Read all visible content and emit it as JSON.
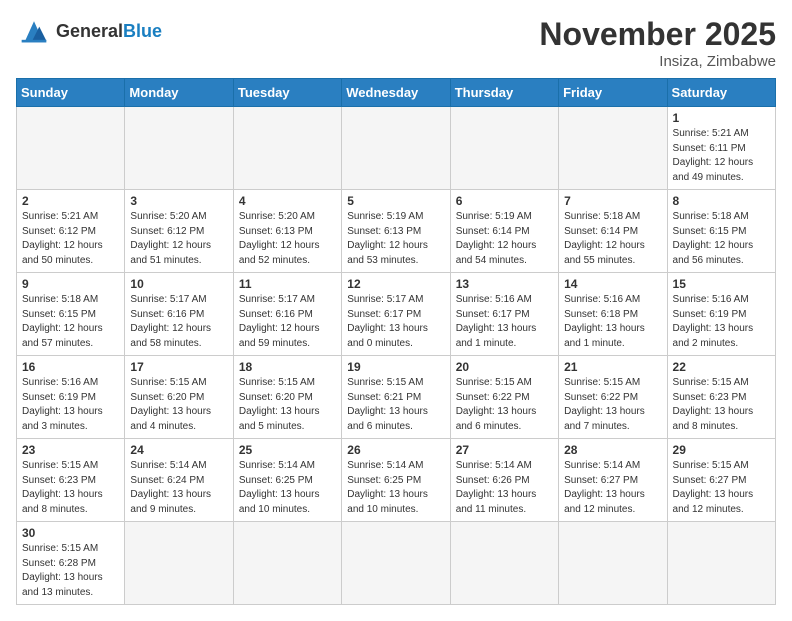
{
  "header": {
    "logo_general": "General",
    "logo_blue": "Blue",
    "month_title": "November 2025",
    "location": "Insiza, Zimbabwe"
  },
  "days_of_week": [
    "Sunday",
    "Monday",
    "Tuesday",
    "Wednesday",
    "Thursday",
    "Friday",
    "Saturday"
  ],
  "weeks": [
    [
      {
        "day": "",
        "info": ""
      },
      {
        "day": "",
        "info": ""
      },
      {
        "day": "",
        "info": ""
      },
      {
        "day": "",
        "info": ""
      },
      {
        "day": "",
        "info": ""
      },
      {
        "day": "",
        "info": ""
      },
      {
        "day": "1",
        "info": "Sunrise: 5:21 AM\nSunset: 6:11 PM\nDaylight: 12 hours\nand 49 minutes."
      }
    ],
    [
      {
        "day": "2",
        "info": "Sunrise: 5:21 AM\nSunset: 6:12 PM\nDaylight: 12 hours\nand 50 minutes."
      },
      {
        "day": "3",
        "info": "Sunrise: 5:20 AM\nSunset: 6:12 PM\nDaylight: 12 hours\nand 51 minutes."
      },
      {
        "day": "4",
        "info": "Sunrise: 5:20 AM\nSunset: 6:13 PM\nDaylight: 12 hours\nand 52 minutes."
      },
      {
        "day": "5",
        "info": "Sunrise: 5:19 AM\nSunset: 6:13 PM\nDaylight: 12 hours\nand 53 minutes."
      },
      {
        "day": "6",
        "info": "Sunrise: 5:19 AM\nSunset: 6:14 PM\nDaylight: 12 hours\nand 54 minutes."
      },
      {
        "day": "7",
        "info": "Sunrise: 5:18 AM\nSunset: 6:14 PM\nDaylight: 12 hours\nand 55 minutes."
      },
      {
        "day": "8",
        "info": "Sunrise: 5:18 AM\nSunset: 6:15 PM\nDaylight: 12 hours\nand 56 minutes."
      }
    ],
    [
      {
        "day": "9",
        "info": "Sunrise: 5:18 AM\nSunset: 6:15 PM\nDaylight: 12 hours\nand 57 minutes."
      },
      {
        "day": "10",
        "info": "Sunrise: 5:17 AM\nSunset: 6:16 PM\nDaylight: 12 hours\nand 58 minutes."
      },
      {
        "day": "11",
        "info": "Sunrise: 5:17 AM\nSunset: 6:16 PM\nDaylight: 12 hours\nand 59 minutes."
      },
      {
        "day": "12",
        "info": "Sunrise: 5:17 AM\nSunset: 6:17 PM\nDaylight: 13 hours\nand 0 minutes."
      },
      {
        "day": "13",
        "info": "Sunrise: 5:16 AM\nSunset: 6:17 PM\nDaylight: 13 hours\nand 1 minute."
      },
      {
        "day": "14",
        "info": "Sunrise: 5:16 AM\nSunset: 6:18 PM\nDaylight: 13 hours\nand 1 minute."
      },
      {
        "day": "15",
        "info": "Sunrise: 5:16 AM\nSunset: 6:19 PM\nDaylight: 13 hours\nand 2 minutes."
      }
    ],
    [
      {
        "day": "16",
        "info": "Sunrise: 5:16 AM\nSunset: 6:19 PM\nDaylight: 13 hours\nand 3 minutes."
      },
      {
        "day": "17",
        "info": "Sunrise: 5:15 AM\nSunset: 6:20 PM\nDaylight: 13 hours\nand 4 minutes."
      },
      {
        "day": "18",
        "info": "Sunrise: 5:15 AM\nSunset: 6:20 PM\nDaylight: 13 hours\nand 5 minutes."
      },
      {
        "day": "19",
        "info": "Sunrise: 5:15 AM\nSunset: 6:21 PM\nDaylight: 13 hours\nand 6 minutes."
      },
      {
        "day": "20",
        "info": "Sunrise: 5:15 AM\nSunset: 6:22 PM\nDaylight: 13 hours\nand 6 minutes."
      },
      {
        "day": "21",
        "info": "Sunrise: 5:15 AM\nSunset: 6:22 PM\nDaylight: 13 hours\nand 7 minutes."
      },
      {
        "day": "22",
        "info": "Sunrise: 5:15 AM\nSunset: 6:23 PM\nDaylight: 13 hours\nand 8 minutes."
      }
    ],
    [
      {
        "day": "23",
        "info": "Sunrise: 5:15 AM\nSunset: 6:23 PM\nDaylight: 13 hours\nand 8 minutes."
      },
      {
        "day": "24",
        "info": "Sunrise: 5:14 AM\nSunset: 6:24 PM\nDaylight: 13 hours\nand 9 minutes."
      },
      {
        "day": "25",
        "info": "Sunrise: 5:14 AM\nSunset: 6:25 PM\nDaylight: 13 hours\nand 10 minutes."
      },
      {
        "day": "26",
        "info": "Sunrise: 5:14 AM\nSunset: 6:25 PM\nDaylight: 13 hours\nand 10 minutes."
      },
      {
        "day": "27",
        "info": "Sunrise: 5:14 AM\nSunset: 6:26 PM\nDaylight: 13 hours\nand 11 minutes."
      },
      {
        "day": "28",
        "info": "Sunrise: 5:14 AM\nSunset: 6:27 PM\nDaylight: 13 hours\nand 12 minutes."
      },
      {
        "day": "29",
        "info": "Sunrise: 5:15 AM\nSunset: 6:27 PM\nDaylight: 13 hours\nand 12 minutes."
      }
    ],
    [
      {
        "day": "30",
        "info": "Sunrise: 5:15 AM\nSunset: 6:28 PM\nDaylight: 13 hours\nand 13 minutes."
      },
      {
        "day": "",
        "info": ""
      },
      {
        "day": "",
        "info": ""
      },
      {
        "day": "",
        "info": ""
      },
      {
        "day": "",
        "info": ""
      },
      {
        "day": "",
        "info": ""
      },
      {
        "day": "",
        "info": ""
      }
    ]
  ]
}
